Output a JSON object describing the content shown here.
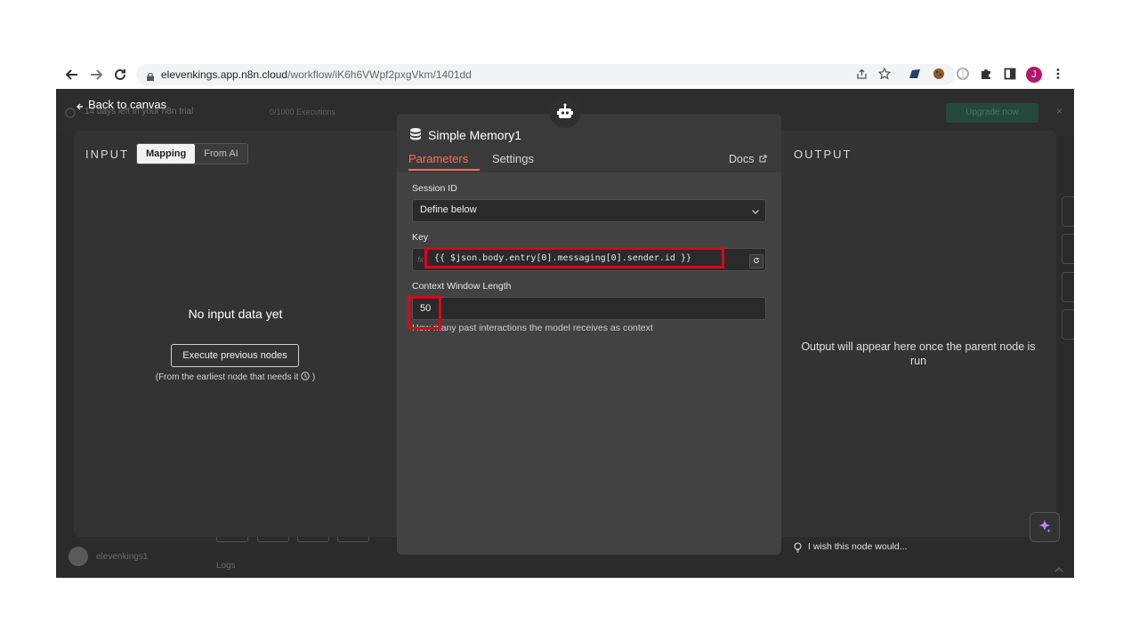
{
  "browser": {
    "url_host": "elevenkings.app.n8n.cloud",
    "url_path": "/workflow/iK6h6VWpf2pxgVkm/1401dd",
    "profile_initial": "J",
    "icons": [
      "back-arrow-icon",
      "forward-arrow-icon",
      "reload-icon",
      "lock-icon",
      "share-icon",
      "star-icon",
      "extension-icon",
      "cookie-icon",
      "extension-icon",
      "puzzle-icon",
      "side-panel-icon",
      "menu-kebab-icon"
    ]
  },
  "app_header": {
    "back_label": "Back to canvas",
    "trial_text": "14 days left in your n8n trial",
    "executions_text": "0/1000 Executions",
    "upgrade_label": "Upgrade now",
    "close_label": "×"
  },
  "input_panel": {
    "title": "INPUT",
    "toggle": [
      "Mapping",
      "From AI"
    ],
    "empty_title": "No input data yet",
    "execute_button": "Execute previous nodes",
    "note": "(From the earliest node that needs it"
  },
  "node": {
    "title": "Simple Memory1",
    "tabs": [
      "Parameters",
      "Settings"
    ],
    "docs_label": "Docs",
    "fields": {
      "session_id": {
        "label": "Session ID",
        "value": "Define below"
      },
      "key": {
        "label": "Key",
        "value": "{{ $json.body.entry[0].messaging[0].sender.id }}",
        "fx": "fx"
      },
      "context_window": {
        "label": "Context Window Length",
        "value": "50",
        "help": "How many past interactions the model receives as context"
      }
    }
  },
  "output_panel": {
    "title": "OUTPUT",
    "empty_text": "Output will appear here once the parent node is run"
  },
  "footer": {
    "user_name": "elevenkings1",
    "logs_label": "Logs",
    "wish_text": "I wish this node would..."
  },
  "colors": {
    "accent": "#ff6d5a",
    "highlight": "#e0001b",
    "panel": "#333334",
    "dialog": "#424243"
  }
}
